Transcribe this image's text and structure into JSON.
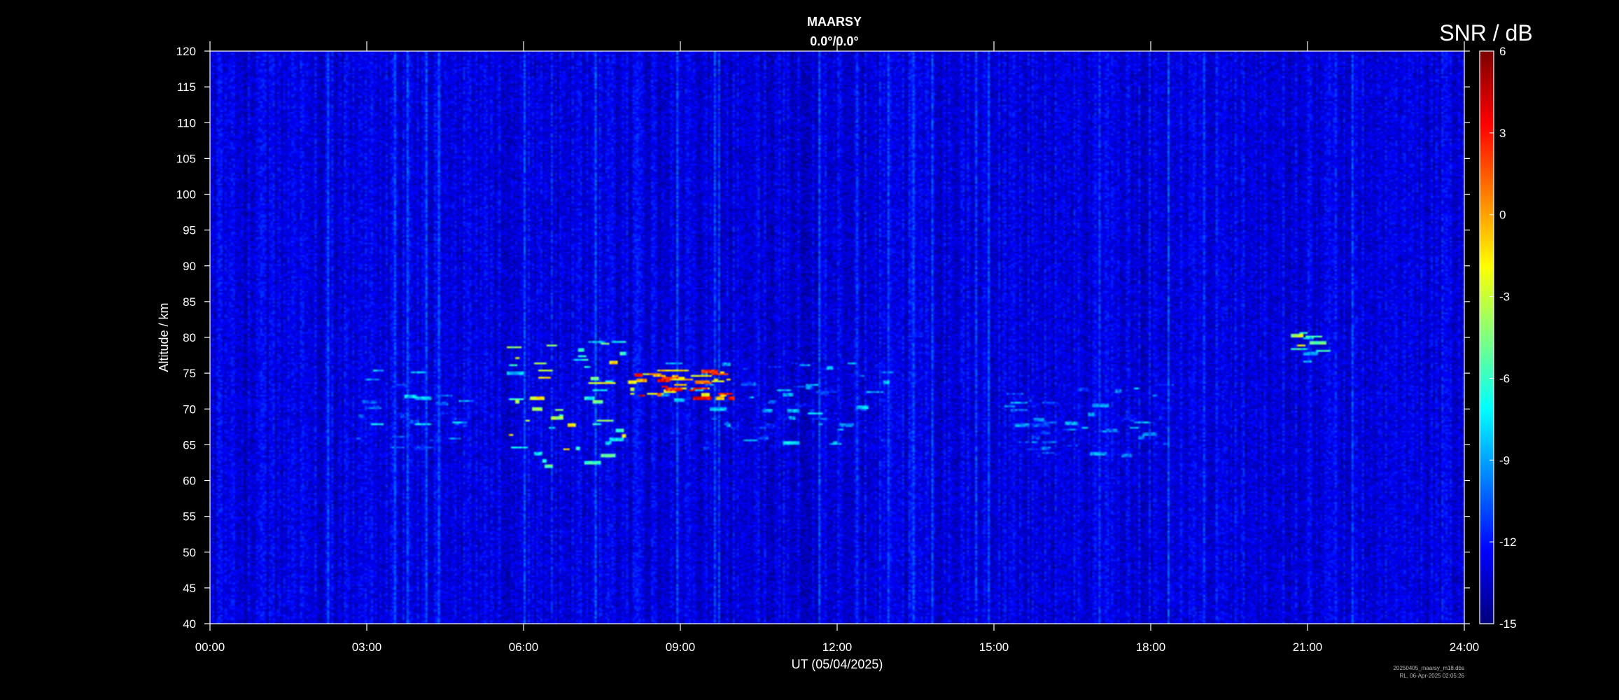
{
  "chart_data": {
    "type": "heatmap",
    "title": "MAARSY",
    "subtitle": "0.0°/0.0°",
    "xlabel": "UT (05/04/2025)",
    "ylabel": "Altitude / km",
    "xlim": [
      0,
      24
    ],
    "ylim": [
      40,
      120
    ],
    "x_ticks": [
      "00:00",
      "03:00",
      "06:00",
      "09:00",
      "12:00",
      "15:00",
      "18:00",
      "21:00",
      "24:00"
    ],
    "y_ticks": [
      120,
      115,
      110,
      105,
      100,
      95,
      90,
      85,
      80,
      75,
      70,
      65,
      60,
      55,
      50,
      45,
      40
    ],
    "colorbar": {
      "label": "SNR / dB",
      "range": [
        -15,
        6
      ],
      "ticks": [
        "6",
        "3",
        "0",
        "-3",
        "-6",
        "-9",
        "-12",
        "-15"
      ],
      "colormap": "jet"
    },
    "background_snr": -13,
    "echo_regions": [
      {
        "t_start": 2.7,
        "t_end": 4.8,
        "alt_min": 64.5,
        "alt_max": 75.5,
        "peak_snr": -6
      },
      {
        "t_start": 5.7,
        "t_end": 7.9,
        "alt_min": 62,
        "alt_max": 79.5,
        "peak_snr": 0
      },
      {
        "t_start": 8.0,
        "t_end": 10.0,
        "alt_min": 71.5,
        "alt_max": 75.5,
        "peak_snr": 5
      },
      {
        "t_start": 8.5,
        "t_end": 12.9,
        "alt_min": 64.5,
        "alt_max": 76.5,
        "peak_snr": -6
      },
      {
        "t_start": 15.2,
        "t_end": 18.5,
        "alt_min": 63.5,
        "alt_max": 73.5,
        "peak_snr": -7
      },
      {
        "t_start": 20.7,
        "t_end": 21.2,
        "alt_min": 76.5,
        "alt_max": 81,
        "peak_snr": -1
      }
    ],
    "footer": [
      "20250405_maarsy_m18.dbs",
      "RL, 06-Apr-2025 02:05:26"
    ]
  }
}
